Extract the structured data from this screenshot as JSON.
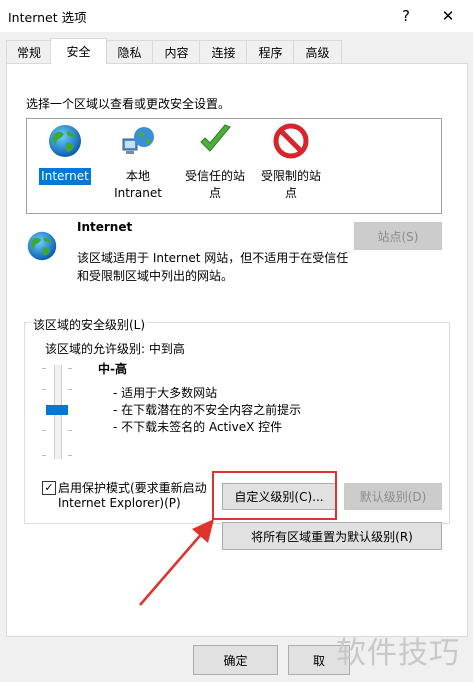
{
  "window": {
    "title": "Internet 选项",
    "help": "?",
    "close": "✕"
  },
  "tabs": [
    {
      "label": "常规"
    },
    {
      "label": "安全"
    },
    {
      "label": "隐私"
    },
    {
      "label": "内容"
    },
    {
      "label": "连接"
    },
    {
      "label": "程序"
    },
    {
      "label": "高级"
    }
  ],
  "security": {
    "prompt": "选择一个区域以查看或更改安全设置。",
    "zones": [
      {
        "line1": "Internet",
        "line2": "",
        "icon": "globe-icon"
      },
      {
        "line1": "本地",
        "line2": "Intranet",
        "icon": "intranet-icon"
      },
      {
        "line1": "受信任的站",
        "line2": "点",
        "icon": "checkmark-icon"
      },
      {
        "line1": "受限制的站",
        "line2": "点",
        "icon": "restricted-icon"
      }
    ],
    "zone_title": "Internet",
    "zone_desc_1": "该区域适用于 Internet 网站，但不适用于在受信任",
    "zone_desc_2": "和受限制区域中列出的网站。",
    "sites_button": "站点(S)",
    "group_label": "该区域的安全级别(L)",
    "allowed_levels": "该区域的允许级别: 中到高",
    "level_name": "中-高",
    "bullets": [
      "- 适用于大多数网站",
      "- 在下载潜在的不安全内容之前提示",
      "- 不下载未签名的 ActiveX 控件"
    ],
    "protected_mode_1": "启用保护模式(要求重新启动",
    "protected_mode_2": "Internet Explorer)(P)",
    "protected_mode_checked": "✓",
    "custom_level_button": "自定义级别(C)...",
    "default_level_button": "默认级别(D)",
    "reset_all_button": "将所有区域重置为默认级别(R)"
  },
  "footer": {
    "ok": "确定",
    "cancel": "取"
  },
  "watermark": "软件技巧",
  "colors": {
    "accent": "#0078d7",
    "highlight_box": "#e0322f",
    "arrow": "#e0322f"
  }
}
